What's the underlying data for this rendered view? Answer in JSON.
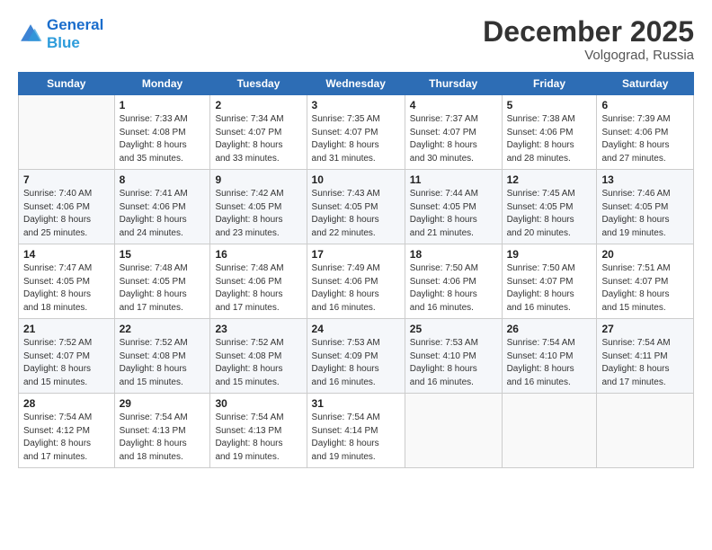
{
  "header": {
    "logo_line1": "General",
    "logo_line2": "Blue",
    "month_title": "December 2025",
    "location": "Volgograd, Russia"
  },
  "weekdays": [
    "Sunday",
    "Monday",
    "Tuesday",
    "Wednesday",
    "Thursday",
    "Friday",
    "Saturday"
  ],
  "weeks": [
    [
      {
        "day": "",
        "sunrise": "",
        "sunset": "",
        "daylight": ""
      },
      {
        "day": "1",
        "sunrise": "Sunrise: 7:33 AM",
        "sunset": "Sunset: 4:08 PM",
        "daylight": "Daylight: 8 hours and 35 minutes."
      },
      {
        "day": "2",
        "sunrise": "Sunrise: 7:34 AM",
        "sunset": "Sunset: 4:07 PM",
        "daylight": "Daylight: 8 hours and 33 minutes."
      },
      {
        "day": "3",
        "sunrise": "Sunrise: 7:35 AM",
        "sunset": "Sunset: 4:07 PM",
        "daylight": "Daylight: 8 hours and 31 minutes."
      },
      {
        "day": "4",
        "sunrise": "Sunrise: 7:37 AM",
        "sunset": "Sunset: 4:07 PM",
        "daylight": "Daylight: 8 hours and 30 minutes."
      },
      {
        "day": "5",
        "sunrise": "Sunrise: 7:38 AM",
        "sunset": "Sunset: 4:06 PM",
        "daylight": "Daylight: 8 hours and 28 minutes."
      },
      {
        "day": "6",
        "sunrise": "Sunrise: 7:39 AM",
        "sunset": "Sunset: 4:06 PM",
        "daylight": "Daylight: 8 hours and 27 minutes."
      }
    ],
    [
      {
        "day": "7",
        "sunrise": "Sunrise: 7:40 AM",
        "sunset": "Sunset: 4:06 PM",
        "daylight": "Daylight: 8 hours and 25 minutes."
      },
      {
        "day": "8",
        "sunrise": "Sunrise: 7:41 AM",
        "sunset": "Sunset: 4:06 PM",
        "daylight": "Daylight: 8 hours and 24 minutes."
      },
      {
        "day": "9",
        "sunrise": "Sunrise: 7:42 AM",
        "sunset": "Sunset: 4:05 PM",
        "daylight": "Daylight: 8 hours and 23 minutes."
      },
      {
        "day": "10",
        "sunrise": "Sunrise: 7:43 AM",
        "sunset": "Sunset: 4:05 PM",
        "daylight": "Daylight: 8 hours and 22 minutes."
      },
      {
        "day": "11",
        "sunrise": "Sunrise: 7:44 AM",
        "sunset": "Sunset: 4:05 PM",
        "daylight": "Daylight: 8 hours and 21 minutes."
      },
      {
        "day": "12",
        "sunrise": "Sunrise: 7:45 AM",
        "sunset": "Sunset: 4:05 PM",
        "daylight": "Daylight: 8 hours and 20 minutes."
      },
      {
        "day": "13",
        "sunrise": "Sunrise: 7:46 AM",
        "sunset": "Sunset: 4:05 PM",
        "daylight": "Daylight: 8 hours and 19 minutes."
      }
    ],
    [
      {
        "day": "14",
        "sunrise": "Sunrise: 7:47 AM",
        "sunset": "Sunset: 4:05 PM",
        "daylight": "Daylight: 8 hours and 18 minutes."
      },
      {
        "day": "15",
        "sunrise": "Sunrise: 7:48 AM",
        "sunset": "Sunset: 4:05 PM",
        "daylight": "Daylight: 8 hours and 17 minutes."
      },
      {
        "day": "16",
        "sunrise": "Sunrise: 7:48 AM",
        "sunset": "Sunset: 4:06 PM",
        "daylight": "Daylight: 8 hours and 17 minutes."
      },
      {
        "day": "17",
        "sunrise": "Sunrise: 7:49 AM",
        "sunset": "Sunset: 4:06 PM",
        "daylight": "Daylight: 8 hours and 16 minutes."
      },
      {
        "day": "18",
        "sunrise": "Sunrise: 7:50 AM",
        "sunset": "Sunset: 4:06 PM",
        "daylight": "Daylight: 8 hours and 16 minutes."
      },
      {
        "day": "19",
        "sunrise": "Sunrise: 7:50 AM",
        "sunset": "Sunset: 4:07 PM",
        "daylight": "Daylight: 8 hours and 16 minutes."
      },
      {
        "day": "20",
        "sunrise": "Sunrise: 7:51 AM",
        "sunset": "Sunset: 4:07 PM",
        "daylight": "Daylight: 8 hours and 15 minutes."
      }
    ],
    [
      {
        "day": "21",
        "sunrise": "Sunrise: 7:52 AM",
        "sunset": "Sunset: 4:07 PM",
        "daylight": "Daylight: 8 hours and 15 minutes."
      },
      {
        "day": "22",
        "sunrise": "Sunrise: 7:52 AM",
        "sunset": "Sunset: 4:08 PM",
        "daylight": "Daylight: 8 hours and 15 minutes."
      },
      {
        "day": "23",
        "sunrise": "Sunrise: 7:52 AM",
        "sunset": "Sunset: 4:08 PM",
        "daylight": "Daylight: 8 hours and 15 minutes."
      },
      {
        "day": "24",
        "sunrise": "Sunrise: 7:53 AM",
        "sunset": "Sunset: 4:09 PM",
        "daylight": "Daylight: 8 hours and 16 minutes."
      },
      {
        "day": "25",
        "sunrise": "Sunrise: 7:53 AM",
        "sunset": "Sunset: 4:10 PM",
        "daylight": "Daylight: 8 hours and 16 minutes."
      },
      {
        "day": "26",
        "sunrise": "Sunrise: 7:54 AM",
        "sunset": "Sunset: 4:10 PM",
        "daylight": "Daylight: 8 hours and 16 minutes."
      },
      {
        "day": "27",
        "sunrise": "Sunrise: 7:54 AM",
        "sunset": "Sunset: 4:11 PM",
        "daylight": "Daylight: 8 hours and 17 minutes."
      }
    ],
    [
      {
        "day": "28",
        "sunrise": "Sunrise: 7:54 AM",
        "sunset": "Sunset: 4:12 PM",
        "daylight": "Daylight: 8 hours and 17 minutes."
      },
      {
        "day": "29",
        "sunrise": "Sunrise: 7:54 AM",
        "sunset": "Sunset: 4:13 PM",
        "daylight": "Daylight: 8 hours and 18 minutes."
      },
      {
        "day": "30",
        "sunrise": "Sunrise: 7:54 AM",
        "sunset": "Sunset: 4:13 PM",
        "daylight": "Daylight: 8 hours and 19 minutes."
      },
      {
        "day": "31",
        "sunrise": "Sunrise: 7:54 AM",
        "sunset": "Sunset: 4:14 PM",
        "daylight": "Daylight: 8 hours and 19 minutes."
      },
      {
        "day": "",
        "sunrise": "",
        "sunset": "",
        "daylight": ""
      },
      {
        "day": "",
        "sunrise": "",
        "sunset": "",
        "daylight": ""
      },
      {
        "day": "",
        "sunrise": "",
        "sunset": "",
        "daylight": ""
      }
    ]
  ]
}
